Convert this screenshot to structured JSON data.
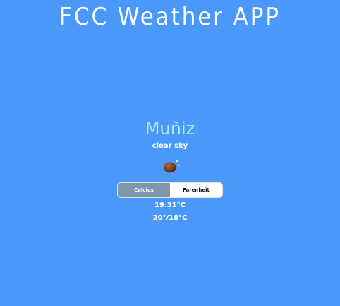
{
  "app": {
    "title": "FCC Weather APP"
  },
  "weather": {
    "city": "Muñiz",
    "description": "clear sky",
    "icon": "clear-night-moon-icon",
    "temperature": "19.31°C",
    "min_max": "20°/18°C"
  },
  "units": {
    "celsius_label": "Celcius",
    "fahrenheit_label": "Farenheit",
    "selected": "Celcius"
  },
  "colors": {
    "background": "#4b98fb",
    "city_text": "#a9ecf2",
    "active_unit_bg": "#7e97ac"
  }
}
